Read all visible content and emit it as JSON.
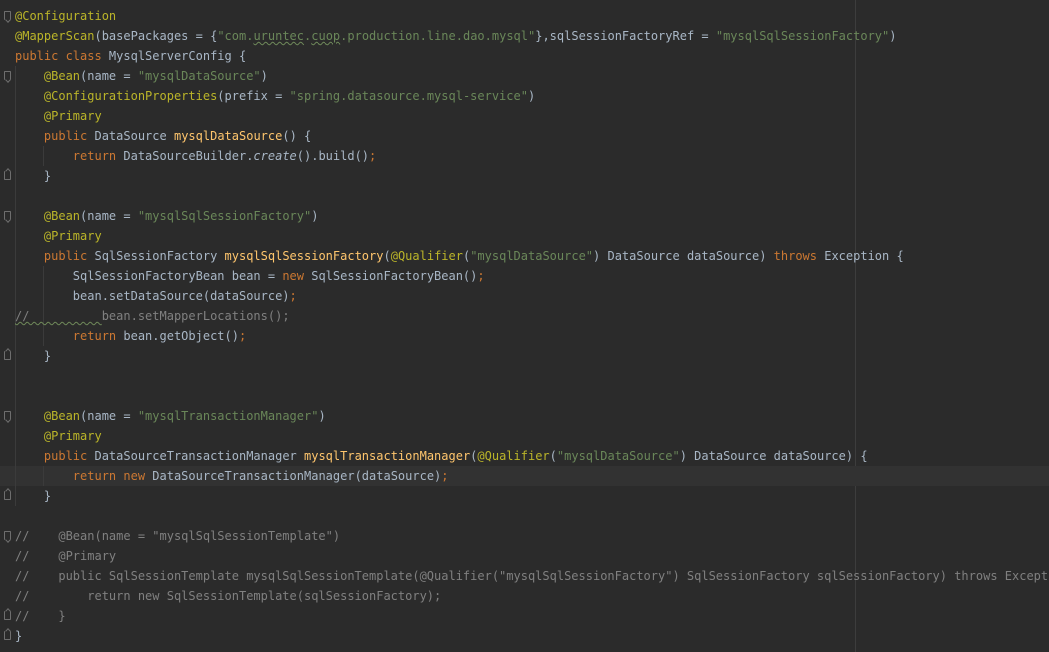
{
  "editor": {
    "colors": {
      "background": "#2b2b2b",
      "current_line": "#323232",
      "annotation": "#bbb529",
      "keyword": "#cc7832",
      "string": "#6a8759",
      "method": "#ffc66d",
      "comment": "#808080",
      "text": "#a9b7c6"
    },
    "lines": [
      {
        "fold": "open",
        "guides": 0,
        "tokens": [
          {
            "t": "ann",
            "v": "@Configuration"
          }
        ]
      },
      {
        "fold": "",
        "guides": 0,
        "tokens": [
          {
            "t": "ann",
            "v": "@MapperScan"
          },
          {
            "t": "pl",
            "v": "(basePackages = {"
          },
          {
            "t": "str",
            "v": "\"com."
          },
          {
            "t": "str typo",
            "v": "uruntec"
          },
          {
            "t": "str",
            "v": "."
          },
          {
            "t": "str typo",
            "v": "cuop"
          },
          {
            "t": "str",
            "v": ".production.line.dao.mysql\""
          },
          {
            "t": "pl",
            "v": "},sqlSessionFactoryRef = "
          },
          {
            "t": "str",
            "v": "\"mysqlSqlSessionFactory\""
          },
          {
            "t": "pl",
            "v": ")"
          }
        ]
      },
      {
        "fold": "",
        "guides": 0,
        "tokens": [
          {
            "t": "kw",
            "v": "public class "
          },
          {
            "t": "pl",
            "v": "MysqlServerConfig {"
          }
        ]
      },
      {
        "fold": "open",
        "guides": 1,
        "tokens": [
          {
            "t": "pl",
            "v": "    "
          },
          {
            "t": "ann",
            "v": "@Bean"
          },
          {
            "t": "pl",
            "v": "(name = "
          },
          {
            "t": "str",
            "v": "\"mysqlDataSource\""
          },
          {
            "t": "pl",
            "v": ")"
          }
        ]
      },
      {
        "fold": "",
        "guides": 1,
        "tokens": [
          {
            "t": "pl",
            "v": "    "
          },
          {
            "t": "ann",
            "v": "@ConfigurationProperties"
          },
          {
            "t": "pl",
            "v": "(prefix = "
          },
          {
            "t": "str",
            "v": "\"spring.datasource.mysql-service\""
          },
          {
            "t": "pl",
            "v": ")"
          }
        ]
      },
      {
        "fold": "",
        "guides": 1,
        "tokens": [
          {
            "t": "pl",
            "v": "    "
          },
          {
            "t": "ann",
            "v": "@Primary"
          }
        ]
      },
      {
        "fold": "",
        "guides": 1,
        "tokens": [
          {
            "t": "pl",
            "v": "    "
          },
          {
            "t": "kw",
            "v": "public "
          },
          {
            "t": "pl",
            "v": "DataSource "
          },
          {
            "t": "fn",
            "v": "mysqlDataSource"
          },
          {
            "t": "pl",
            "v": "() {"
          }
        ]
      },
      {
        "fold": "",
        "guides": 2,
        "tokens": [
          {
            "t": "pl",
            "v": "        "
          },
          {
            "t": "kw",
            "v": "return "
          },
          {
            "t": "pl",
            "v": "DataSourceBuilder."
          },
          {
            "t": "pl it",
            "v": "create"
          },
          {
            "t": "pl",
            "v": "().build()"
          },
          {
            "t": "kw",
            "v": ";"
          }
        ]
      },
      {
        "fold": "close",
        "guides": 1,
        "tokens": [
          {
            "t": "pl",
            "v": "    }"
          }
        ]
      },
      {
        "fold": "",
        "guides": 1,
        "tokens": []
      },
      {
        "fold": "open",
        "guides": 1,
        "tokens": [
          {
            "t": "pl",
            "v": "    "
          },
          {
            "t": "ann",
            "v": "@Bean"
          },
          {
            "t": "pl",
            "v": "(name = "
          },
          {
            "t": "str",
            "v": "\"mysqlSqlSessionFactory\""
          },
          {
            "t": "pl",
            "v": ")"
          }
        ]
      },
      {
        "fold": "",
        "guides": 1,
        "tokens": [
          {
            "t": "pl",
            "v": "    "
          },
          {
            "t": "ann",
            "v": "@Primary"
          }
        ]
      },
      {
        "fold": "",
        "guides": 1,
        "tokens": [
          {
            "t": "pl",
            "v": "    "
          },
          {
            "t": "kw",
            "v": "public "
          },
          {
            "t": "pl",
            "v": "SqlSessionFactory "
          },
          {
            "t": "fn",
            "v": "mysqlSqlSessionFactory"
          },
          {
            "t": "pl",
            "v": "("
          },
          {
            "t": "ann",
            "v": "@Qualifier"
          },
          {
            "t": "pl",
            "v": "("
          },
          {
            "t": "str",
            "v": "\"mysqlDataSource\""
          },
          {
            "t": "pl",
            "v": ") DataSource dataSource) "
          },
          {
            "t": "kw",
            "v": "throws "
          },
          {
            "t": "pl",
            "v": "Exception {"
          }
        ]
      },
      {
        "fold": "",
        "guides": 2,
        "tokens": [
          {
            "t": "pl",
            "v": "        SqlSessionFactoryBean bean = "
          },
          {
            "t": "kw",
            "v": "new "
          },
          {
            "t": "pl",
            "v": "SqlSessionFactoryBean()"
          },
          {
            "t": "kw",
            "v": ";"
          }
        ]
      },
      {
        "fold": "",
        "guides": 2,
        "tokens": [
          {
            "t": "pl",
            "v": "        bean.setDataSource(dataSource)"
          },
          {
            "t": "kw",
            "v": ";"
          }
        ]
      },
      {
        "fold": "",
        "guides": 2,
        "tokens": [
          {
            "t": "com typo",
            "v": "//          "
          },
          {
            "t": "com",
            "v": "bean.setMapperLocations();"
          }
        ]
      },
      {
        "fold": "",
        "guides": 2,
        "tokens": [
          {
            "t": "pl",
            "v": "        "
          },
          {
            "t": "kw",
            "v": "return "
          },
          {
            "t": "pl",
            "v": "bean.getObject()"
          },
          {
            "t": "kw",
            "v": ";"
          }
        ]
      },
      {
        "fold": "close",
        "guides": 1,
        "tokens": [
          {
            "t": "pl",
            "v": "    }"
          }
        ]
      },
      {
        "fold": "",
        "guides": 1,
        "tokens": []
      },
      {
        "fold": "",
        "guides": 1,
        "tokens": []
      },
      {
        "fold": "open",
        "guides": 1,
        "tokens": [
          {
            "t": "pl",
            "v": "    "
          },
          {
            "t": "ann",
            "v": "@Bean"
          },
          {
            "t": "pl",
            "v": "(name = "
          },
          {
            "t": "str",
            "v": "\"mysqlTransactionManager\""
          },
          {
            "t": "pl",
            "v": ")"
          }
        ]
      },
      {
        "fold": "",
        "guides": 1,
        "tokens": [
          {
            "t": "pl",
            "v": "    "
          },
          {
            "t": "ann",
            "v": "@Primary"
          }
        ]
      },
      {
        "fold": "",
        "guides": 1,
        "tokens": [
          {
            "t": "pl",
            "v": "    "
          },
          {
            "t": "kw",
            "v": "public "
          },
          {
            "t": "pl",
            "v": "DataSourceTransactionManager "
          },
          {
            "t": "fn",
            "v": "mysqlTransactionManager"
          },
          {
            "t": "pl",
            "v": "("
          },
          {
            "t": "ann",
            "v": "@Qualifier"
          },
          {
            "t": "pl",
            "v": "("
          },
          {
            "t": "str",
            "v": "\"mysqlDataSource\""
          },
          {
            "t": "pl",
            "v": ") DataSource dataSource) {"
          }
        ]
      },
      {
        "fold": "",
        "guides": 2,
        "current": true,
        "tokens": [
          {
            "t": "pl",
            "v": "        "
          },
          {
            "t": "kw",
            "v": "return new "
          },
          {
            "t": "pl",
            "v": "DataSourceTransactionManager(dataSource)"
          },
          {
            "t": "kw",
            "v": ";"
          }
        ]
      },
      {
        "fold": "close",
        "guides": 1,
        "tokens": [
          {
            "t": "pl",
            "v": "    }"
          }
        ]
      },
      {
        "fold": "",
        "guides": 0,
        "tokens": []
      },
      {
        "fold": "open",
        "guides": 0,
        "tokens": [
          {
            "t": "com",
            "v": "//    @Bean(name = \"mysqlSqlSessionTemplate\")"
          }
        ]
      },
      {
        "fold": "",
        "guides": 0,
        "tokens": [
          {
            "t": "com",
            "v": "//    @Primary"
          }
        ]
      },
      {
        "fold": "",
        "guides": 0,
        "tokens": [
          {
            "t": "com",
            "v": "//    public SqlSessionTemplate mysqlSqlSessionTemplate(@Qualifier(\"mysqlSqlSessionFactory\") SqlSessionFactory sqlSessionFactory) throws Exception {"
          }
        ]
      },
      {
        "fold": "",
        "guides": 0,
        "tokens": [
          {
            "t": "com",
            "v": "//        return new SqlSessionTemplate(sqlSessionFactory);"
          }
        ]
      },
      {
        "fold": "close",
        "guides": 0,
        "tokens": [
          {
            "t": "com",
            "v": "//    }"
          }
        ]
      },
      {
        "fold": "close",
        "guides": 0,
        "tokens": [
          {
            "t": "pl",
            "v": "}"
          }
        ]
      }
    ]
  }
}
